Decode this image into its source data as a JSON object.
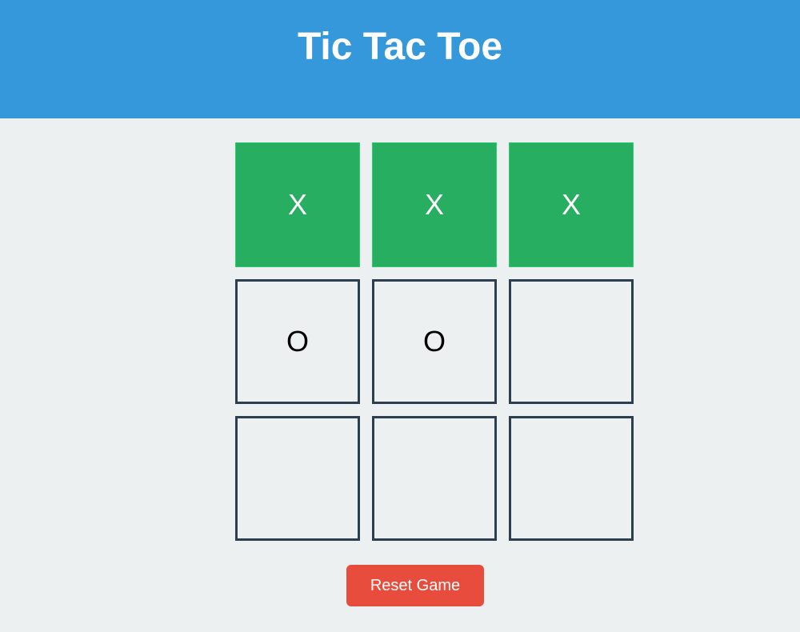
{
  "header": {
    "title": "Tic Tac Toe"
  },
  "board": {
    "cells": [
      {
        "value": "X",
        "winning": true
      },
      {
        "value": "X",
        "winning": true
      },
      {
        "value": "X",
        "winning": true
      },
      {
        "value": "O",
        "winning": false
      },
      {
        "value": "O",
        "winning": false
      },
      {
        "value": "",
        "winning": false
      },
      {
        "value": "",
        "winning": false
      },
      {
        "value": "",
        "winning": false
      },
      {
        "value": "",
        "winning": false
      }
    ]
  },
  "controls": {
    "reset_label": "Reset Game"
  },
  "colors": {
    "header": "#3498db",
    "win": "#27ae60",
    "reset": "#e74c3c",
    "border": "#2c3e50",
    "background": "#ecf0f1"
  }
}
